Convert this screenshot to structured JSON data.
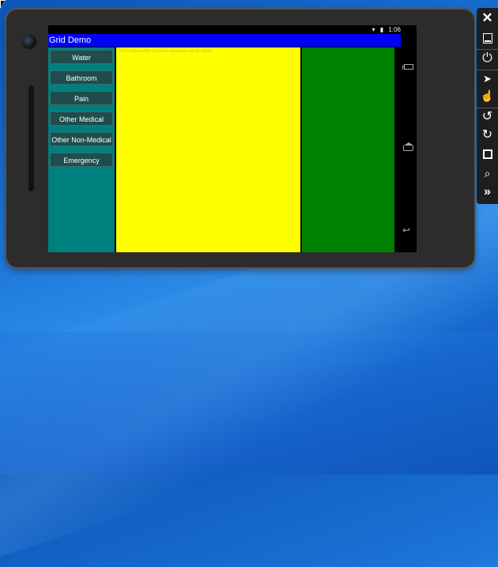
{
  "status": {
    "time": "1:06",
    "wifi_icon": "wifi-icon",
    "battery_icon": "battery-icon"
  },
  "app": {
    "title": "Grid Demo",
    "buttons": [
      "Water",
      "Bathroom",
      "Pain",
      "Other Medical",
      "Other Non-Medical",
      "Emergency"
    ],
    "message_hint": "This is where different status messages will be shown"
  },
  "colors": {
    "title_bar": "#0000ff",
    "left_panel": "#007f7f",
    "message_area": "#ffff00",
    "right_panel": "#008000"
  },
  "toolbar": {
    "icons": [
      "close-icon",
      "minimize-icon",
      "power-icon",
      "pointer-icon",
      "touch-icon",
      "rotate-left-icon",
      "rotate-right-icon",
      "fullscreen-icon",
      "zoom-icon",
      "more-icon"
    ]
  }
}
